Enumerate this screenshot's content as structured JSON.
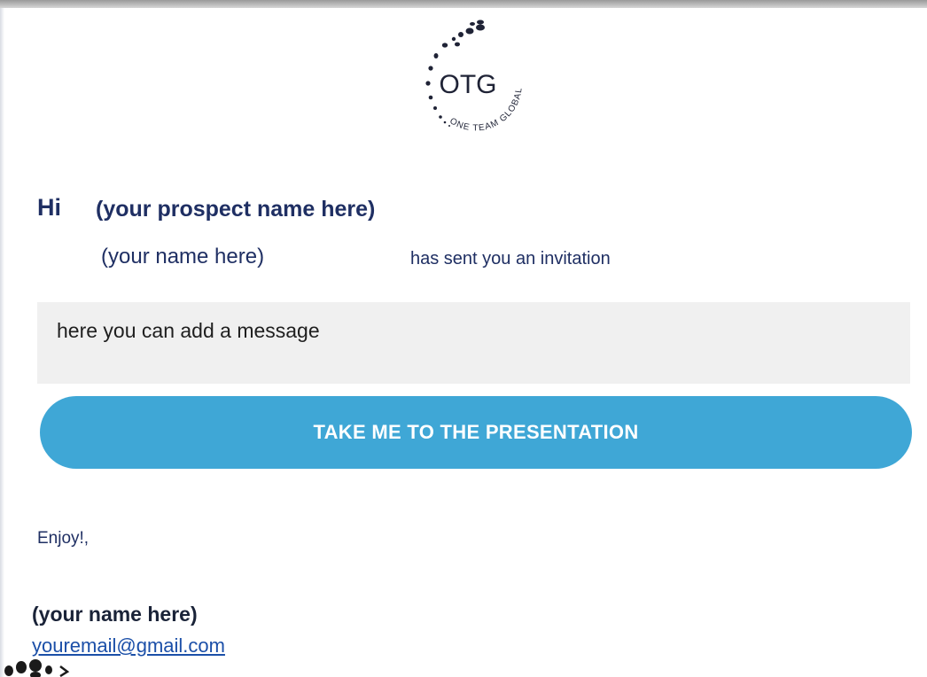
{
  "logo": {
    "icon": "otg-logo-icon",
    "text": "OTG",
    "arc_text": "ONE TEAM GLOBAL"
  },
  "greeting": {
    "hi": "Hi",
    "prospect_name": "(your prospect name here)"
  },
  "invitation": {
    "sender_name": "(your  name here)",
    "text": "has sent you an invitation"
  },
  "message": {
    "text": "here you can add a message"
  },
  "cta": {
    "label": "TAKE ME TO THE PRESENTATION",
    "color": "#3fa7d6"
  },
  "signoff": {
    "text": "Enjoy!,"
  },
  "signature": {
    "name": "(your  name here)",
    "email": "youremail@gmail.com"
  },
  "colors": {
    "navy": "#1f2f63",
    "link": "#1b4fa8",
    "message_bg": "#f0f0f0"
  }
}
